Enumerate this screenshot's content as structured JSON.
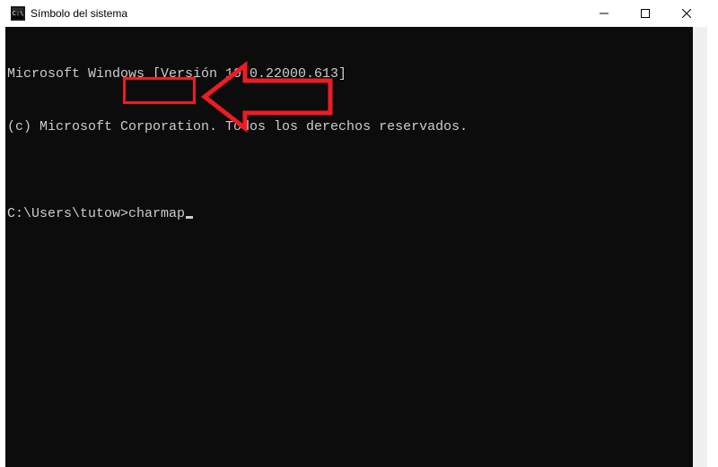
{
  "window": {
    "title": "Símbolo del sistema"
  },
  "terminal": {
    "line1": "Microsoft Windows [Versión 10.0.22000.613]",
    "line2": "(c) Microsoft Corporation. Todos los derechos reservados.",
    "blank": "",
    "prompt": "C:\\Users\\tutow>",
    "command": "charmap"
  },
  "annotation": {
    "highlight_color": "#ed1c24"
  }
}
